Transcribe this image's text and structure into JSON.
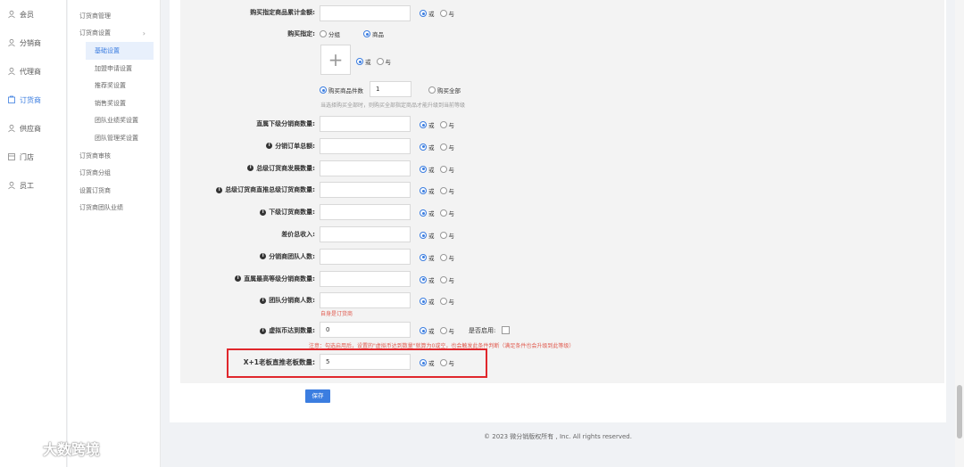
{
  "nav_primary": [
    {
      "label": "会员",
      "icon": "user-icon",
      "active": false
    },
    {
      "label": "分销商",
      "icon": "user-icon",
      "active": false
    },
    {
      "label": "代理商",
      "icon": "user-icon",
      "active": false
    },
    {
      "label": "订货商",
      "icon": "cart-icon",
      "active": true
    },
    {
      "label": "供应商",
      "icon": "user-icon",
      "active": false
    },
    {
      "label": "门店",
      "icon": "store-icon",
      "active": false
    },
    {
      "label": "员工",
      "icon": "user-icon",
      "active": false
    }
  ],
  "nav_secondary": {
    "items": [
      "订货商管理",
      "订货商设置",
      "基础设置",
      "加盟申请设置",
      "推荐奖设置",
      "销售奖设置",
      "团队业绩奖设置",
      "团队管理奖设置",
      "订货商审核",
      "订货商分组",
      "设置订货商",
      "订货商团队业绩"
    ]
  },
  "form": {
    "buy_amount_label": "购买指定商品累计金额:",
    "buy_spec_label": "购买指定:",
    "opt_group": "分组",
    "opt_product": "商品",
    "or": "或",
    "and": "与",
    "buy_qty_label": "购买商品件数",
    "buy_qty_value": "1",
    "buy_all_label": "购买全部",
    "buy_all_hint": "当选择购买全部时，则购买全部指定商品才能升级到当前等级",
    "rows": [
      {
        "label": "直属下级分销商数量:",
        "info": false,
        "value": ""
      },
      {
        "label": "分销订单总额:",
        "info": true,
        "value": ""
      },
      {
        "label": "总级订货商发展数量:",
        "info": true,
        "value": ""
      },
      {
        "label": "总级订货商直推总级订货商数量:",
        "info": true,
        "value": ""
      },
      {
        "label": "下级订货商数量:",
        "info": true,
        "value": ""
      },
      {
        "label": "差价总收入:",
        "info": false,
        "value": ""
      },
      {
        "label": "分销商团队人数:",
        "info": true,
        "value": ""
      },
      {
        "label": "直属最高等级分销商数量:",
        "info": true,
        "value": ""
      },
      {
        "label": "团队分销商人数:",
        "info": true,
        "value": ""
      }
    ],
    "self_only_note": "自身是订货商",
    "vcoin_label": "虚拟币达到数量:",
    "vcoin_value": "0",
    "enable_label": "是否启用:",
    "vcoin_warn": "注意：勾选启用后，设置的\"虚拟币达到数量\"就算为0或空，也会触发此条件判断（满足条件也会升级到此等级）",
    "x1_label": "X+1老板直推老板数量:",
    "x1_value": "5",
    "save_label": "保存"
  },
  "footer": "© 2023 微分销版权所有 , Inc. All rights reserved.",
  "watermark": "大数跨境",
  "colors": {
    "accent": "#3b7de0",
    "highlight": "#e0272c",
    "warn": "#e05a4e"
  }
}
